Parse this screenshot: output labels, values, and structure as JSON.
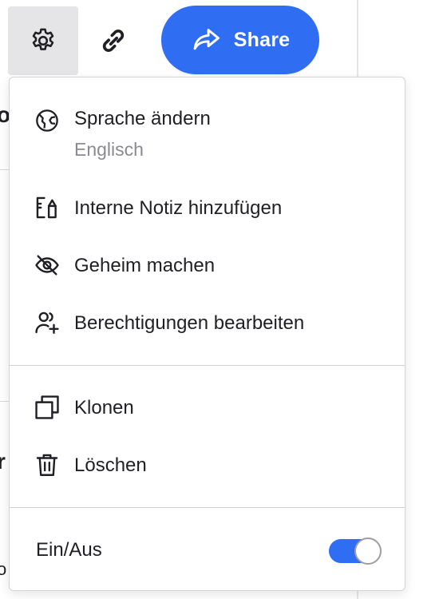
{
  "toolbar": {
    "settings_icon": "gear-icon",
    "link_icon": "link-icon",
    "share_icon": "share-arrow-icon",
    "share_label": "Share",
    "accent_color": "#2f6df2"
  },
  "background": {
    "glyph_1": "o",
    "glyph_2": "r",
    "glyph_3": "o"
  },
  "menu": {
    "language": {
      "label": "Sprache ändern",
      "value": "Englisch",
      "icon": "globe-icon"
    },
    "internal_note": {
      "label": "Interne Notiz hinzufügen",
      "icon": "note-icon"
    },
    "make_secret": {
      "label": "Geheim machen",
      "icon": "eye-off-icon"
    },
    "permissions": {
      "label": "Berechtigungen bearbeiten",
      "icon": "user-add-icon"
    },
    "clone": {
      "label": "Klonen",
      "icon": "copy-icon"
    },
    "delete": {
      "label": "Löschen",
      "icon": "trash-icon"
    },
    "toggle": {
      "label": "Ein/Aus",
      "on": true
    }
  }
}
